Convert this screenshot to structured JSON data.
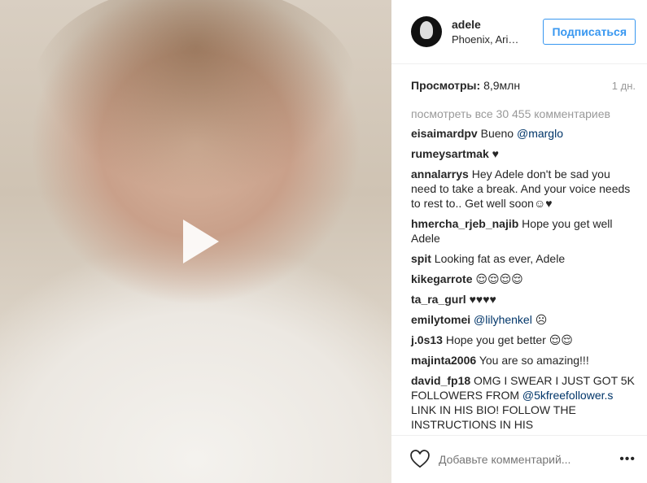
{
  "post": {
    "username": "adele",
    "location": "Phoenix, Ari…",
    "follow_label": "Подписаться",
    "views_label": "Просмотры:",
    "views_value": "8,9млн",
    "time": "1 дн.",
    "load_more": "посмотреть все 30 455 комментариев"
  },
  "comments": [
    {
      "user": "eisaimardpv",
      "text": "Bueno ",
      "mention": "@marglo",
      "tail": ""
    },
    {
      "user": "rumeysartmak",
      "text": "♥",
      "mention": "",
      "tail": ""
    },
    {
      "user": "annalarrys",
      "text": "Hey Adele don't be sad you need to take a break. And your voice needs to rest to.. Get well soon☺♥",
      "mention": "",
      "tail": ""
    },
    {
      "user": "hmercha_rjeb_najib",
      "text": "Hope you get well Adele",
      "mention": "",
      "tail": ""
    },
    {
      "user": "spit",
      "text": "Looking fat as ever, Adele",
      "mention": "",
      "tail": ""
    },
    {
      "user": "kikegarrote",
      "text": "😌😌😌😌",
      "mention": "",
      "tail": ""
    },
    {
      "user": "ta_ra_gurl",
      "text": "♥♥♥♥",
      "mention": "",
      "tail": ""
    },
    {
      "user": "emilytomei",
      "text": "",
      "mention": "@lilyhenkel",
      "tail": " ☹"
    },
    {
      "user": "j.0s13",
      "text": "Hope you get better 😌😌",
      "mention": "",
      "tail": ""
    },
    {
      "user": "majinta2006",
      "text": "You are so amazing!!!",
      "mention": "",
      "tail": ""
    },
    {
      "user": "david_fp18",
      "text": "OMG I SWEAR I JUST GOT 5K FOLLOWERS FROM ",
      "mention": "@5kfreefollower.s",
      "tail": " LINK IN HIS BIO! FOLLOW THE INSTRUCTIONS IN HIS"
    }
  ],
  "footer": {
    "placeholder": "Добавьте комментарий...",
    "more": "•••"
  },
  "icons": {
    "play": "play-icon",
    "heart": "heart-icon",
    "more": "more-options-icon"
  }
}
